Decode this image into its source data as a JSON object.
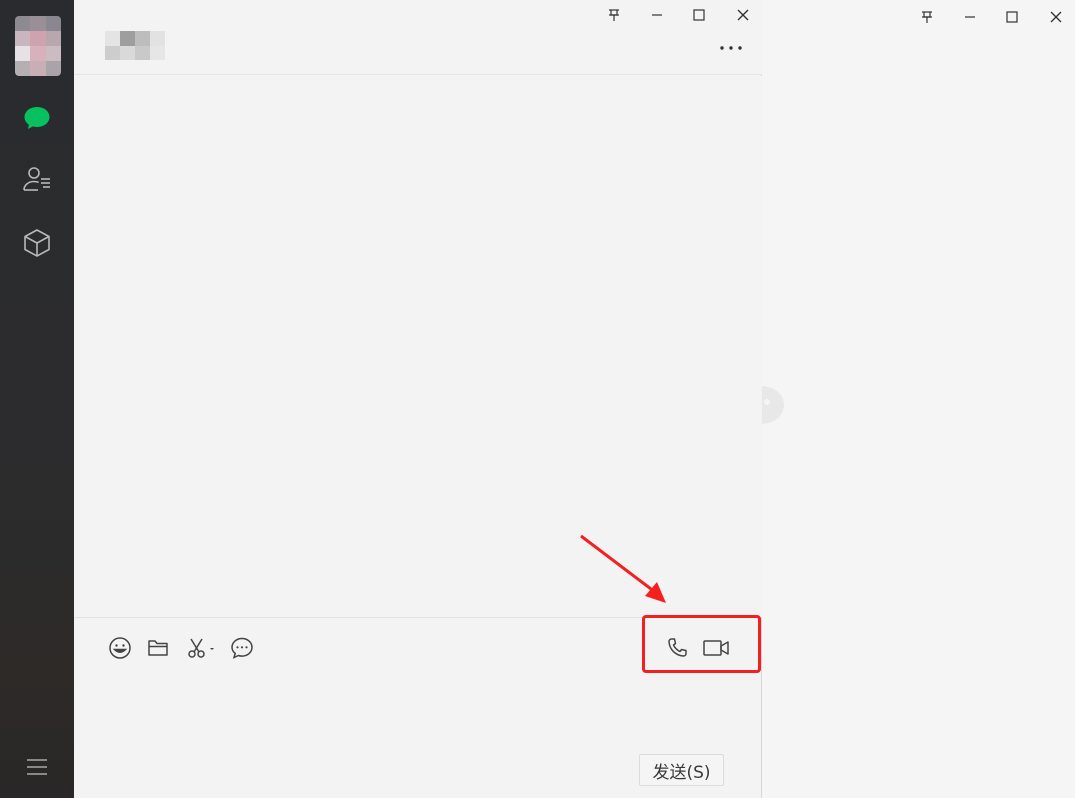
{
  "rail": {
    "icons": [
      "avatar",
      "chat-icon",
      "contacts-icon",
      "mini-programs-icon",
      "menu-icon"
    ],
    "accent_color": "#07c160"
  },
  "chat": {
    "send_label": "发送(S)",
    "toolbar_icons": [
      "emoji-icon",
      "folder-icon",
      "screenshot-icon",
      "chat-history-icon",
      "voice-call-icon",
      "video-call-icon"
    ],
    "window_controls": [
      "pin-icon",
      "minimize-icon",
      "maximize-icon",
      "close-icon"
    ]
  },
  "annotation": {
    "color": "#f42020"
  }
}
